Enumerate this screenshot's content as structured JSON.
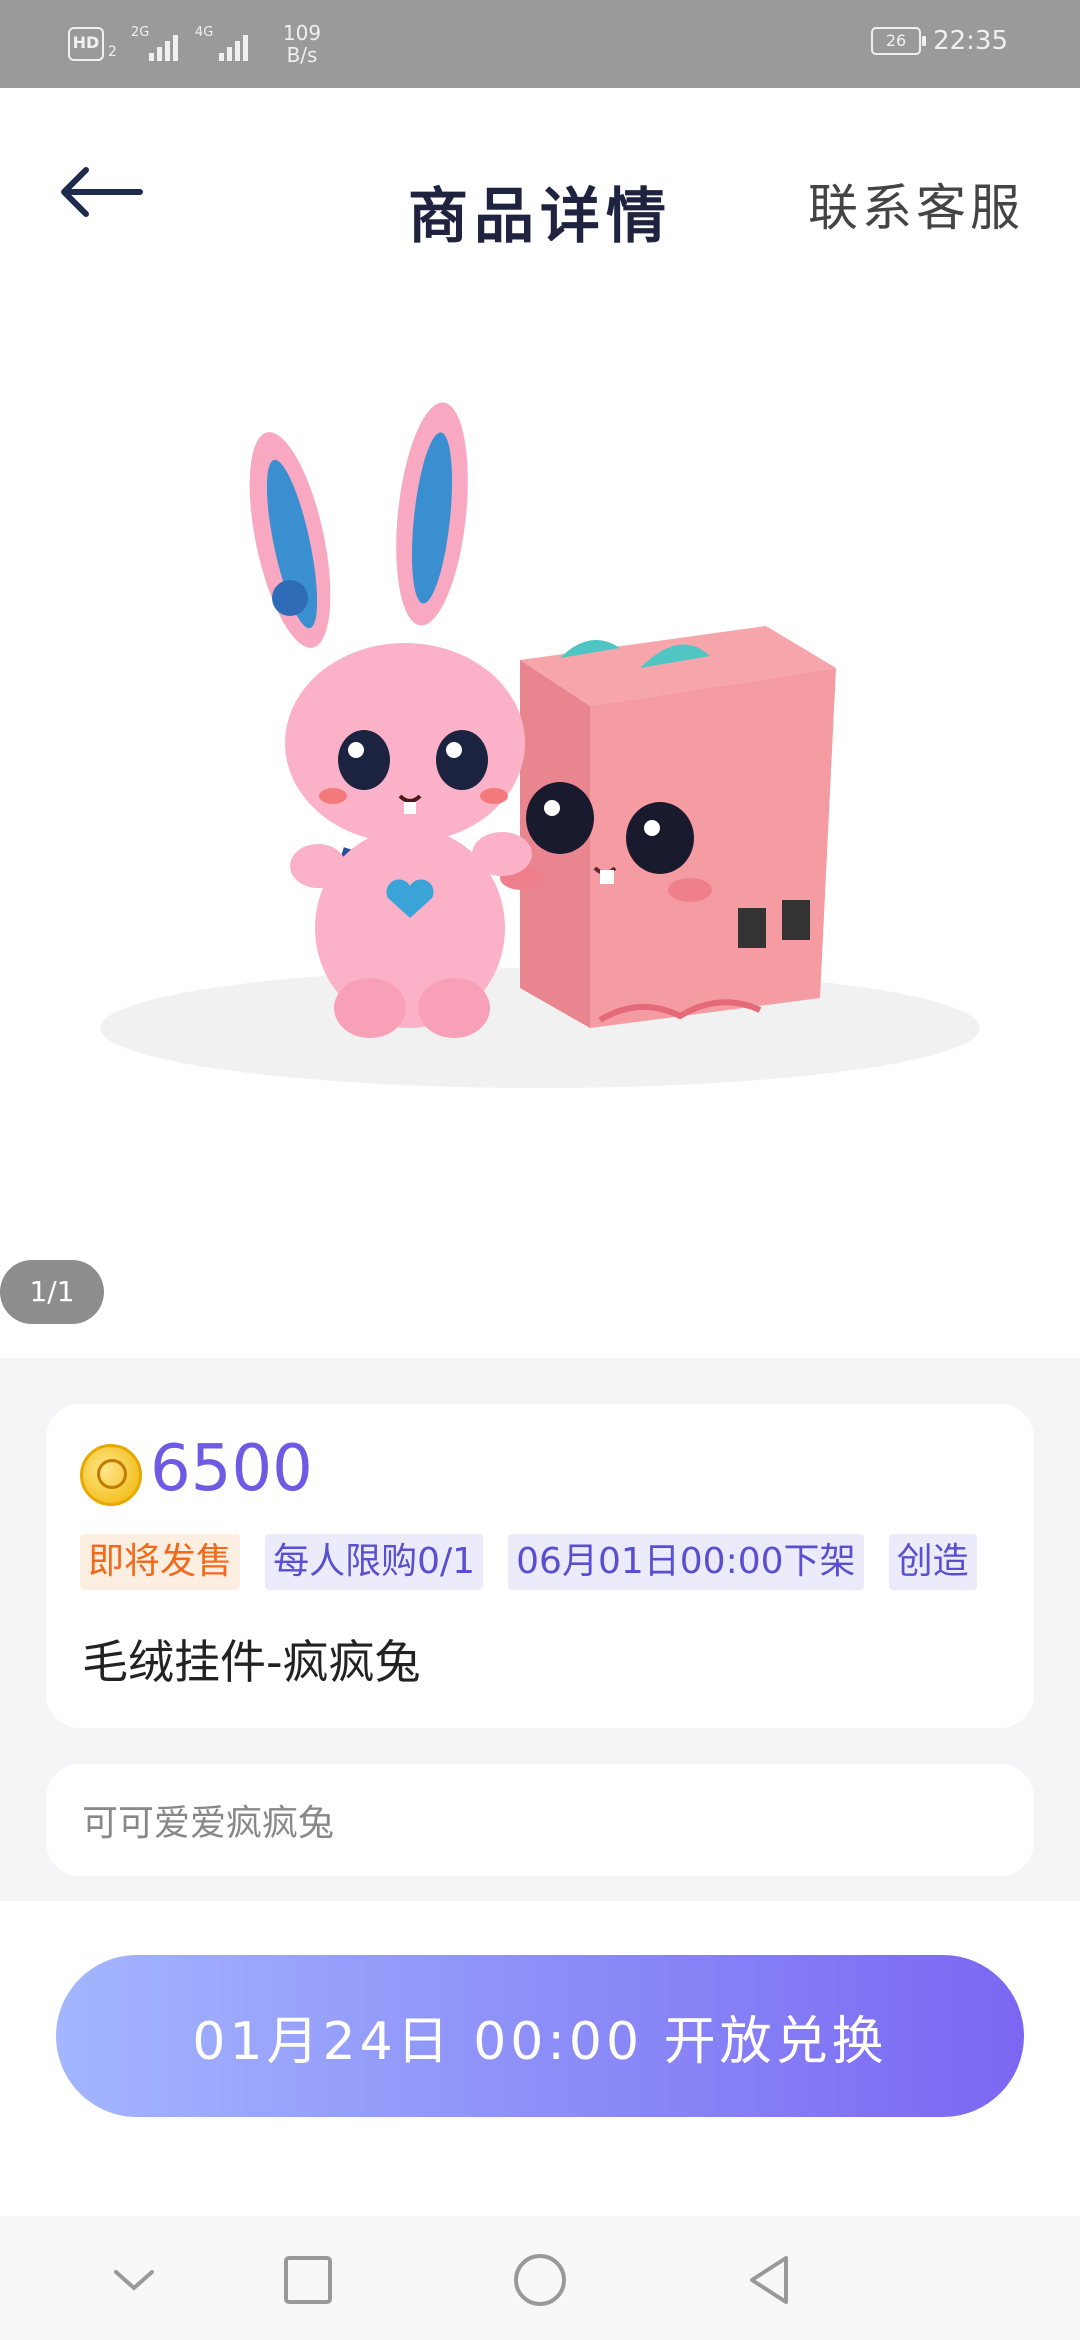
{
  "status_bar": {
    "hd_label": "HD",
    "hd_sub": "2",
    "sig1_label": "2G",
    "sig2_label": "4G",
    "net_speed_value": "109",
    "net_speed_unit": "B/s",
    "battery": "26",
    "time": "22:35"
  },
  "header": {
    "title": "商品详情",
    "contact": "联系客服",
    "back_icon": "arrow-left-icon"
  },
  "gallery": {
    "pager": "1/1",
    "image": "pink plush bunny toy with pink gift box"
  },
  "product": {
    "price": "6500",
    "coin_icon": "coin-icon",
    "tags": [
      {
        "text": "即将发售",
        "style": "orange"
      },
      {
        "text": "每人限购0/1",
        "style": "purple"
      },
      {
        "text": "06月01日00:00下架",
        "style": "purple"
      },
      {
        "text": "创造",
        "style": "purple"
      }
    ],
    "name": "毛绒挂件-疯疯兔",
    "description": "可可爱爱疯疯兔"
  },
  "cta": {
    "label": "01月24日 00:00 开放兑换"
  },
  "colors": {
    "accent": "#6e5be4",
    "tag_orange": "#f06a1a",
    "tag_purple": "#5a4fd0",
    "cta_start": "#a3b6ff",
    "cta_end": "#7b67f2"
  }
}
